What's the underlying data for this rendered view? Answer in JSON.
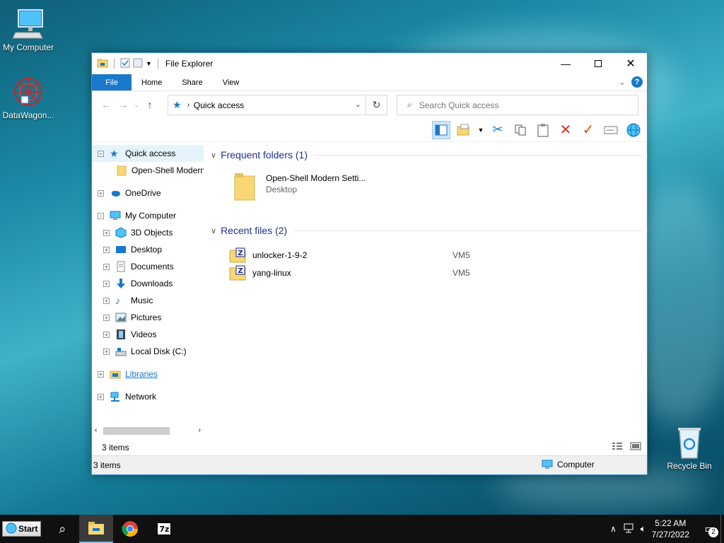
{
  "desktop": {
    "icons": [
      {
        "label": "My Computer"
      },
      {
        "label": "DataWagon..."
      },
      {
        "label": "Recycle Bin"
      }
    ]
  },
  "window": {
    "title": "File Explorer",
    "ribbon_tabs": [
      "File",
      "Home",
      "Share",
      "View"
    ],
    "help_label": "?",
    "address": {
      "location": "Quick access"
    },
    "search": {
      "placeholder": "Search Quick access"
    },
    "nav": {
      "items": [
        {
          "label": "Quick access"
        },
        {
          "label": "Open-Shell Modern Settings"
        },
        {
          "label": "OneDrive"
        },
        {
          "label": "My Computer"
        },
        {
          "label": "3D Objects"
        },
        {
          "label": "Desktop"
        },
        {
          "label": "Documents"
        },
        {
          "label": "Downloads"
        },
        {
          "label": "Music"
        },
        {
          "label": "Pictures"
        },
        {
          "label": "Videos"
        },
        {
          "label": "Local Disk (C:)"
        },
        {
          "label": "Libraries"
        },
        {
          "label": "Network"
        }
      ],
      "status": "3 items"
    },
    "content": {
      "frequent_header": "Frequent folders (1)",
      "frequent": [
        {
          "name": "Open-Shell Modern Setti...",
          "location": "Desktop"
        }
      ],
      "recent_header": "Recent files (2)",
      "recent": [
        {
          "name": "unlocker-1-9-2",
          "location": "VM5"
        },
        {
          "name": "yang-linux",
          "location": "VM5"
        }
      ]
    },
    "statusbar": {
      "items": "3 items",
      "zone": "Computer"
    }
  },
  "taskbar": {
    "start_label": "Start",
    "sevenzip_label": "7z",
    "time": "5:22 AM",
    "date": "7/27/2022",
    "notifications": "2"
  },
  "colors": {
    "accent": "#1979ca",
    "header_text": "#1e3287",
    "taskbar": "#101010"
  }
}
